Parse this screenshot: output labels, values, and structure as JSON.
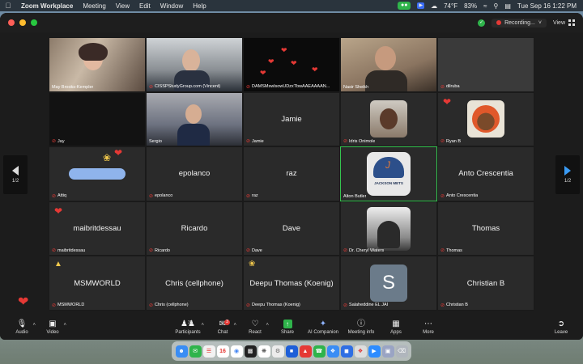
{
  "menubar": {
    "app_name": "Zoom Workplace",
    "menus": [
      "Meeting",
      "View",
      "Edit",
      "Window",
      "Help"
    ],
    "temperature": "74°F",
    "battery": "83%",
    "datetime": "Tue Sep 16  1:22 PM"
  },
  "titlebar": {
    "recording_label": "Recording...",
    "view_label": "View"
  },
  "tiles": [
    {
      "name": "May Brooks-Kempler",
      "center": "",
      "kind": "video"
    },
    {
      "name": "CISSPStudyGroup.com (Vincent)",
      "center": "",
      "kind": "video"
    },
    {
      "name": "DAMSMswlsowUDzxTbwAAEAAAAN...",
      "center": "",
      "kind": "video"
    },
    {
      "name": "Nasir Sheikh",
      "center": "",
      "kind": "video"
    },
    {
      "name": "dilruba",
      "center": "",
      "kind": "video"
    },
    {
      "name": "Jay",
      "center": "",
      "kind": "video"
    },
    {
      "name": "Sergio",
      "center": "",
      "kind": "video"
    },
    {
      "name": "Jamie",
      "center": "Jamie",
      "kind": "name"
    },
    {
      "name": "Idris Onimole",
      "center": "",
      "kind": "avatar"
    },
    {
      "name": "Ryan B",
      "center": "",
      "kind": "avatar"
    },
    {
      "name": "Attiq",
      "center": "",
      "kind": "avatar"
    },
    {
      "name": "epolanco",
      "center": "epolanco",
      "kind": "name"
    },
    {
      "name": "raz",
      "center": "raz",
      "kind": "name"
    },
    {
      "name": "Alton Butler",
      "center": "",
      "kind": "avatar"
    },
    {
      "name": "Anto Crescentia",
      "center": "Anto Crescentia",
      "kind": "name"
    },
    {
      "name": "maibritdessau",
      "center": "maibritdessau",
      "kind": "name"
    },
    {
      "name": "Ricardo",
      "center": "Ricardo",
      "kind": "name"
    },
    {
      "name": "Dave",
      "center": "Dave",
      "kind": "name"
    },
    {
      "name": "Dr. Cheryl Waters",
      "center": "",
      "kind": "avatar"
    },
    {
      "name": "Thomas",
      "center": "Thomas",
      "kind": "name"
    },
    {
      "name": "MSMWORLD",
      "center": "MSMWORLD",
      "kind": "name"
    },
    {
      "name": "Chris (cellphone)",
      "center": "Chris (cellphone)",
      "kind": "name"
    },
    {
      "name": "Deepu Thomas (Koenig)",
      "center": "Deepu Thomas (Koenig)",
      "kind": "name"
    },
    {
      "name": "Salaheddine EL JAI",
      "center": "",
      "kind": "letter"
    },
    {
      "name": "Christian B",
      "center": "Christian B",
      "kind": "name"
    }
  ],
  "avatar_letter": "S",
  "cap_text": "JACKSON METS",
  "pager": {
    "left": "1/2",
    "right": "1/2"
  },
  "toolbar": {
    "audio": "Audio",
    "video": "Video",
    "participants": "Participants",
    "participants_count": "35",
    "chat": "Chat",
    "chat_badge": "3",
    "react": "React",
    "share": "Share",
    "ai_companion": "AI Companion",
    "meeting_info": "Meeting info",
    "apps": "Apps",
    "more": "More",
    "leave": "Leave"
  },
  "dock": {
    "calendar_day": "16"
  },
  "colors": {
    "active_speaker": "#35c44f",
    "muted": "#e53935",
    "share": "#2fb44b"
  }
}
